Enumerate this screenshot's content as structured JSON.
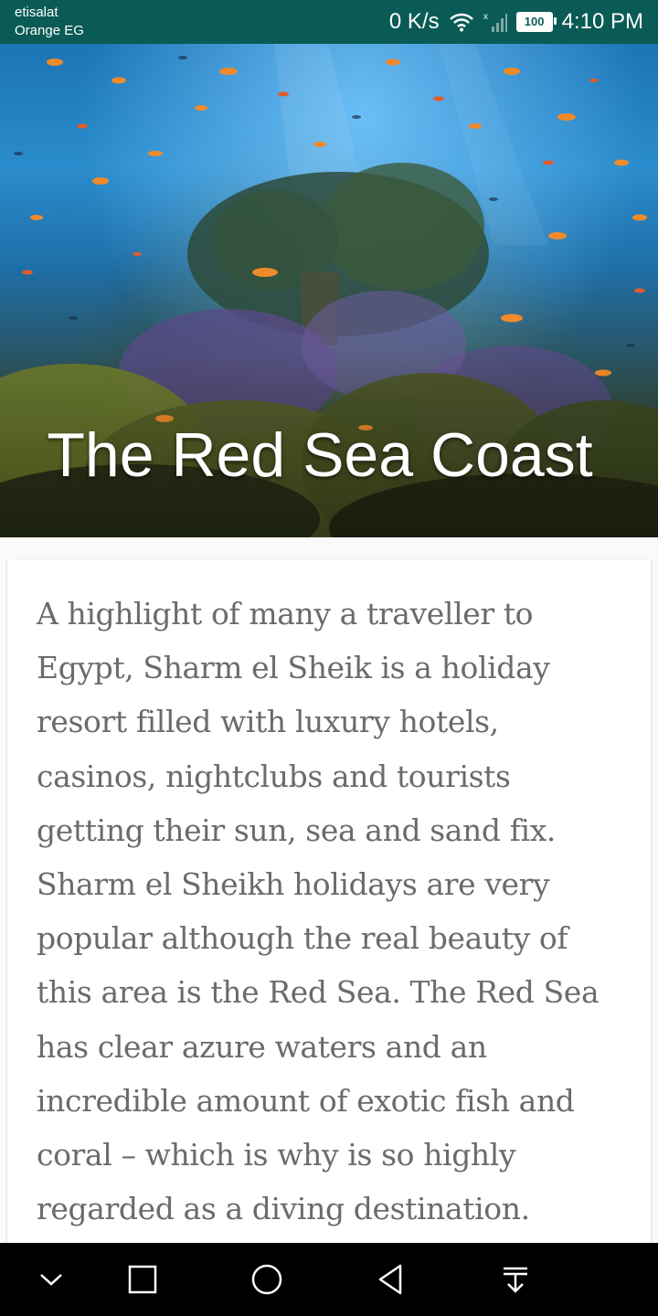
{
  "status_bar": {
    "carrier_line1": "etisalat",
    "carrier_line2": "Orange EG",
    "speed": "0 K/s",
    "battery": "100",
    "time": "4:10 PM",
    "icons": [
      "wifi-icon",
      "signal-icon",
      "battery-icon"
    ],
    "background": "#0a5b55"
  },
  "hero": {
    "title": "The Red Sea Coast",
    "image": "coral-reef-photo"
  },
  "article": {
    "body": "A highlight of many a traveller to Egypt, Sharm el Sheik is a holiday resort filled with luxury hotels, casinos, nightclubs and tourists getting their sun, sea and sand fix. Sharm el Sheikh holidays are very popular although the real beauty of this area is the Red Sea. The Red Sea has clear azure waters and an incredible amount of exotic fish and coral – which is why is so highly regarded as a diving destination."
  },
  "nav_bar": {
    "buttons": [
      "hide-nav-icon",
      "recents-icon",
      "home-icon",
      "back-icon",
      "notifications-pull-icon"
    ]
  }
}
